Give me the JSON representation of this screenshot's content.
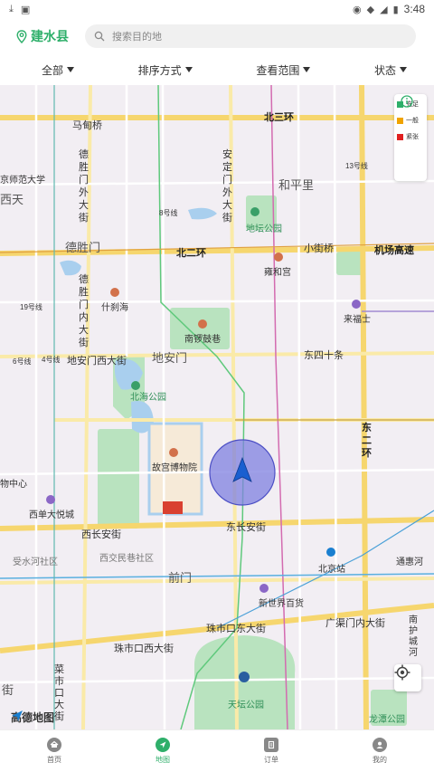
{
  "status_bar": {
    "time": "3:48"
  },
  "header": {
    "city": "建水县",
    "search_placeholder": "搜索目的地"
  },
  "filters": [
    {
      "label": "全部"
    },
    {
      "label": "排序方式"
    },
    {
      "label": "查看范围"
    },
    {
      "label": "状态"
    }
  ],
  "legend": [
    {
      "label": "充足",
      "color": "#2eaf6a"
    },
    {
      "label": "一般",
      "color": "#f0a300"
    },
    {
      "label": "紧张",
      "color": "#e02020"
    }
  ],
  "map": {
    "labels": {
      "beisanhuan": "北三环",
      "mahuaqiao": "马甸桥",
      "heping": "和平里",
      "line13": "13号线",
      "bsd": "京师范大学",
      "xitian": "西天",
      "deshengmenwai": "德胜门外大街",
      "andingmenwai": "安定门外大街",
      "line8": "8号线",
      "ditan": "地坛公园",
      "deshengmen": "德胜门",
      "beierhuan": "北二环",
      "xiaojieqiao": "小街桥",
      "jichang": "机场高速",
      "yonghegong": "雍和宫",
      "deshengnei": "德胜门内大街",
      "shichahai": "什刹海",
      "line19": "19号线",
      "laifushi": "来福士",
      "nanluo": "南锣鼓巷",
      "line6": "6号线",
      "line4": "4号线",
      "dianmenxi": "地安门西大街",
      "dianmen": "地安门",
      "dongsishi": "东四十条",
      "beihai": "北海公园",
      "dongerhuan": "东二环",
      "gugong": "故宫博物院",
      "zhongxin": "物中心",
      "xidanjoy": "西单大悦城",
      "xichangan": "西长安街",
      "dongchangan": "东长安街",
      "shouhe": "受水河社区",
      "xijiaomin": "西交民巷社区",
      "qianmen": "前门",
      "beijingzhan": "北京站",
      "tonghuihe": "通惠河",
      "xinshijie": "新世界百货",
      "guangqumen": "广渠门内大街",
      "zhushikoudong": "珠市口东大街",
      "zhushikouxi": "珠市口西大街",
      "nanhucheng": "南护城河",
      "caishikou": "菜市口大街",
      "jie": "街",
      "tiantan": "天坛公园",
      "longtan": "龙潭公园",
      "amap": "高德地图"
    }
  },
  "tabs": [
    {
      "label": "首页",
      "icon": "home-icon"
    },
    {
      "label": "地图",
      "icon": "map-icon"
    },
    {
      "label": "订单",
      "icon": "order-icon"
    },
    {
      "label": "我的",
      "icon": "profile-icon"
    }
  ]
}
